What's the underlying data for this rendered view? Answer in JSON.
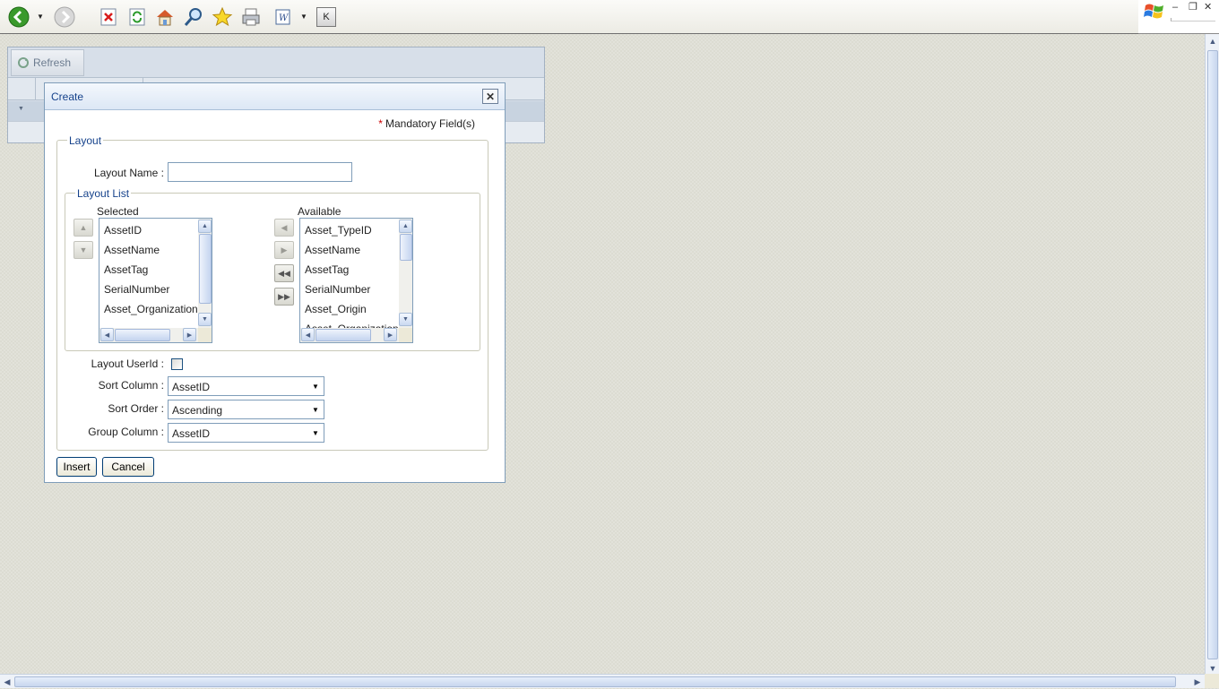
{
  "browser": {
    "icons": [
      "back-icon",
      "forward-icon",
      "stop-icon",
      "refresh-icon",
      "home-icon",
      "search-icon",
      "favorites-icon",
      "print-icon",
      "edit-icon",
      "k-icon"
    ],
    "k_label": "K",
    "window_controls": {
      "minimize": "–",
      "restore": "❐",
      "close": "✕"
    }
  },
  "grid": {
    "refresh_label": "Refresh"
  },
  "dialog": {
    "title": "Create",
    "close_glyph": "✕",
    "mandatory_star": "*",
    "mandatory_text": "Mandatory Field(s)",
    "layout_legend": "Layout",
    "layout_name_label": "Layout Name :",
    "layout_name_value": "",
    "layout_list_legend": "Layout List",
    "selected_label": "Selected",
    "available_label": "Available",
    "selected_items": [
      "AssetID",
      "AssetName",
      "AssetTag",
      "SerialNumber",
      "Asset_Organization"
    ],
    "available_items": [
      "Asset_TypeID",
      "AssetName",
      "AssetTag",
      "SerialNumber",
      "Asset_Origin",
      "Asset_Organization"
    ],
    "layout_userid_label": "Layout UserId :",
    "layout_userid_checked": false,
    "sort_column_label": "Sort Column :",
    "sort_column_value": "AssetID",
    "sort_order_label": "Sort Order :",
    "sort_order_value": "Ascending",
    "group_column_label": "Group Column :",
    "group_column_value": "AssetID",
    "insert_label": "Insert",
    "cancel_label": "Cancel"
  },
  "colors": {
    "dialog_title_text": "#15428b",
    "mandatory_star": "#cc0000",
    "field_border": "#7f9db9"
  }
}
